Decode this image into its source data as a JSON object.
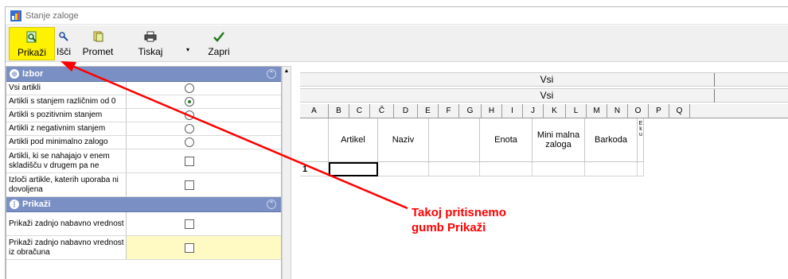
{
  "window": {
    "title": "Stanje zaloge"
  },
  "toolbar": {
    "prikazi": "Prikaži",
    "isci": "Išči",
    "promet": "Promet",
    "tiskaj": "Tiskaj",
    "zapri": "Zapri"
  },
  "sections": {
    "izbor": "Izbor",
    "prikazi": "Prikaži"
  },
  "options": [
    {
      "label": "Vsi artikli",
      "control": "radio",
      "checked": false
    },
    {
      "label": "Artikli s stanjem različnim od 0",
      "control": "radio",
      "checked": true
    },
    {
      "label": "Artikli s pozitivnim stanjem",
      "control": "radio",
      "checked": false
    },
    {
      "label": "Artikli z negativnim stanjem",
      "control": "radio",
      "checked": false
    },
    {
      "label": "Artikli pod minimalno zalogo",
      "control": "radio",
      "checked": false
    },
    {
      "label": "Artikli, ki se nahajajo v enem skladišču v drugem pa ne",
      "control": "checkbox",
      "checked": false
    },
    {
      "label": "Izloči artikle, katerih uporaba ni dovoljena",
      "control": "checkbox",
      "checked": false
    }
  ],
  "display_options": [
    {
      "label": "Prikaži zadnjo nabavno vrednost",
      "control": "checkbox",
      "checked": false
    },
    {
      "label": "Prikaži zadnjo nabavno vrednost iz obračuna",
      "control": "checkbox",
      "checked": false
    }
  ],
  "grid": {
    "band1": "Vsi",
    "band2": "Vsi",
    "column_letters": [
      "A",
      "B",
      "C",
      "Č",
      "D",
      "E",
      "F",
      "G",
      "H",
      "I",
      "J",
      "K",
      "L",
      "M",
      "N",
      "O",
      "P",
      "Q"
    ],
    "headers": [
      "",
      "Artikel",
      "Naziv",
      "",
      "Enota",
      "Mini malna zaloga",
      "Barkoda",
      "E k u"
    ],
    "rows": [
      {
        "num": "1"
      }
    ]
  },
  "annotation": {
    "line1": "Takoj pritisnemo",
    "line2": "gumb  Prikaži"
  },
  "colors": {
    "highlight": "#fff200",
    "section_header": "#7a8fc4",
    "annotation": "#ff0000"
  }
}
